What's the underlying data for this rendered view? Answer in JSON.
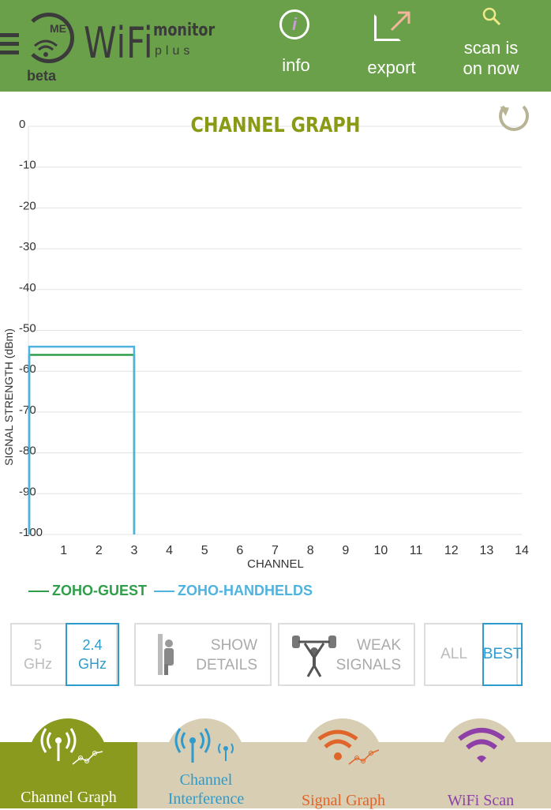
{
  "header": {
    "logo_me": "ME",
    "logo_wifi": "WiFi",
    "logo_monitor": "monitor",
    "logo_plus": "plus",
    "logo_beta": "beta",
    "info_label": "info",
    "export_label": "export",
    "scan_label_line1": "scan is",
    "scan_label_line2": "on now"
  },
  "chart_data": {
    "type": "line",
    "title": "CHANNEL GRAPH",
    "xlabel": "CHANNEL",
    "ylabel": "SIGNAL STRENGTH (dBm)",
    "xlim": [
      0,
      14
    ],
    "ylim": [
      -100,
      0
    ],
    "x_ticks": [
      1,
      2,
      3,
      4,
      5,
      6,
      7,
      8,
      9,
      10,
      11,
      12,
      13,
      14
    ],
    "y_ticks": [
      0,
      -10,
      -20,
      -30,
      -40,
      -50,
      -60,
      -70,
      -80,
      -90,
      -100
    ],
    "grid": true,
    "series": [
      {
        "name": "ZOHO-GUEST",
        "color": "#2e9e4a",
        "x_start": 0,
        "x_end": 3,
        "value": -56
      },
      {
        "name": "ZOHO-HANDHELDS",
        "color": "#4fb3e0",
        "x_start": 0,
        "x_end": 3,
        "value": -54
      }
    ]
  },
  "filters": {
    "band_5": "5\nGHz",
    "band_24": "2.4\nGHz",
    "show_details": "SHOW\nDETAILS",
    "weak_signals": "WEAK\nSIGNALS",
    "all": "ALL",
    "best": "BEST"
  },
  "nav": {
    "tabs": [
      {
        "label": "Channel Graph",
        "color": "#ffffff"
      },
      {
        "label": "Channel\nInterference",
        "color": "#2f9bcc"
      },
      {
        "label": "Signal Graph",
        "color": "#e0652a"
      },
      {
        "label": "WiFi Scan",
        "color": "#8f3fa8"
      }
    ]
  },
  "colors": {
    "header": "#6aa04a",
    "title": "#8a9a14",
    "active_tab": "#8a9a1f",
    "nav_bg": "#d8ceb3",
    "selected": "#2f9bcc"
  }
}
